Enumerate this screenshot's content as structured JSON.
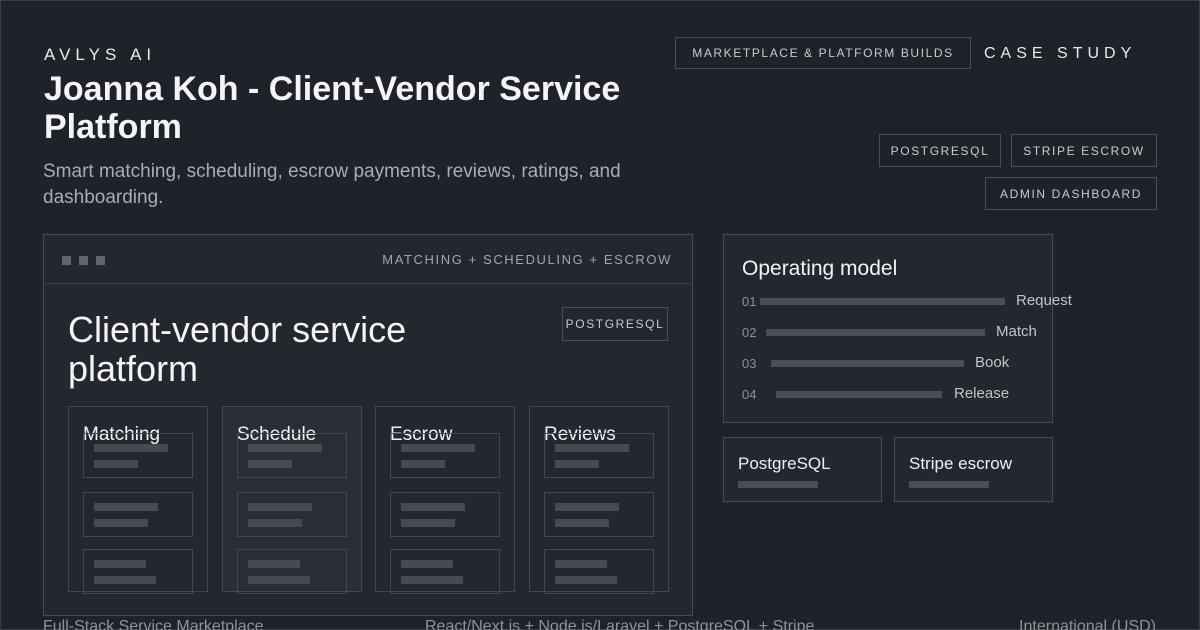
{
  "header": {
    "brand": "AVLYS AI",
    "title": "Joanna Koh - Client-Vendor Service Platform",
    "subtitle": "Smart matching, scheduling, escrow payments, reviews, ratings, and dashboarding.",
    "category_tag": "MARKETPLACE & PLATFORM BUILDS",
    "case_study": "CASE STUDY"
  },
  "tags": [
    "POSTGRESQL",
    "STRIPE ESCROW",
    "ADMIN DASHBOARD"
  ],
  "mockup": {
    "caption": "MATCHING + SCHEDULING + ESCROW",
    "title": "Client-vendor service platform",
    "tag": "POSTGRESQL",
    "columns": [
      "Matching",
      "Schedule",
      "Escrow",
      "Reviews"
    ],
    "active_column": "Schedule"
  },
  "operating_model": {
    "title": "Operating model",
    "steps": [
      {
        "num": "01",
        "label": "Request"
      },
      {
        "num": "02",
        "label": "Match"
      },
      {
        "num": "03",
        "label": "Book"
      },
      {
        "num": "04",
        "label": "Release"
      }
    ]
  },
  "tech_cards": [
    "PostgreSQL",
    "Stripe escrow"
  ],
  "footer": {
    "left": "Full-Stack Service Marketplace",
    "center": "React/Next.js + Node.js/Laravel + PostgreSQL + Stripe",
    "right": "International (USD)"
  },
  "colors": {
    "background": "#1f2228",
    "border": "#474b53",
    "text": "#e9eaec",
    "muted": "#a9acb2"
  }
}
